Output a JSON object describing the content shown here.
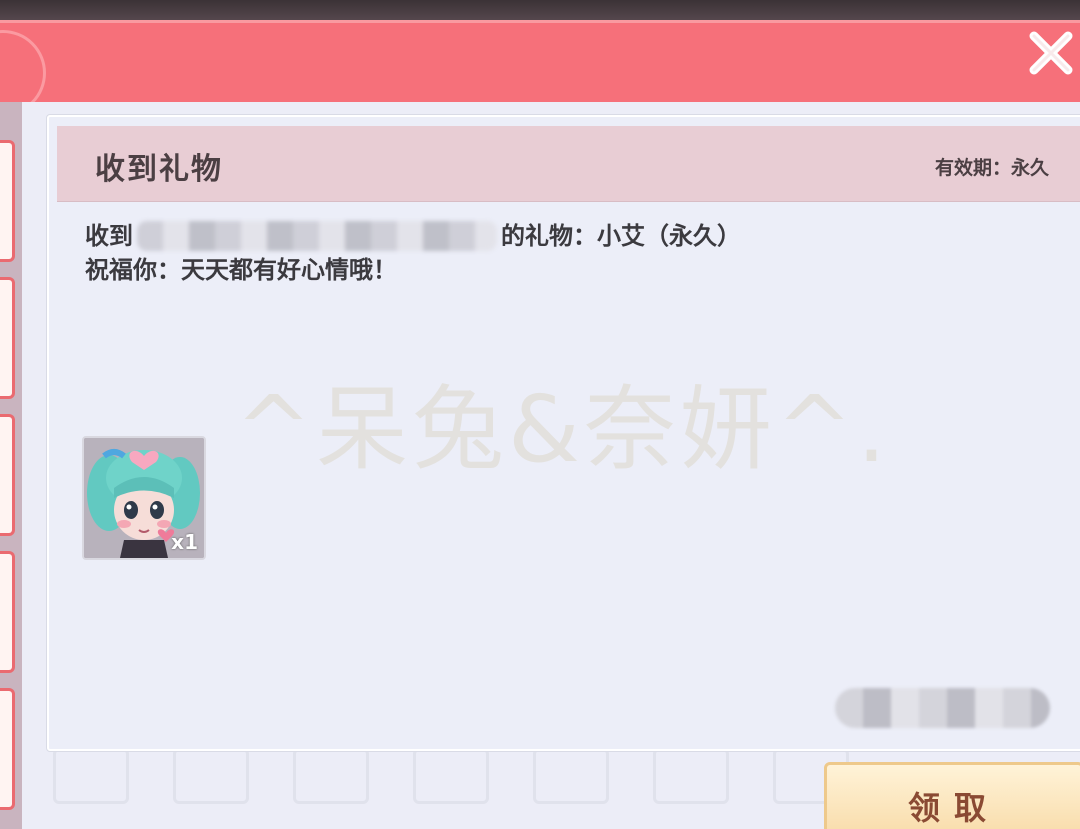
{
  "window": {
    "close_icon": "close-icon"
  },
  "mail": {
    "title": "收到礼物",
    "validity": "有效期：永久",
    "line1_prefix": "收到",
    "line1_suffix": "的礼物：小艾（永久）",
    "line2": "祝福你：天天都有好心情哦！"
  },
  "gift": {
    "icon": "character-avatar-icon",
    "count": "x1"
  },
  "watermark": "^呆兔&奈妍^.",
  "actions": {
    "claim_label": "领取"
  },
  "colors": {
    "header": "#f6707a",
    "mail_header": "#e8cdd4",
    "panel": "#eceef8",
    "claim_button": "#f8dba8",
    "claim_text": "#8a4a33"
  }
}
